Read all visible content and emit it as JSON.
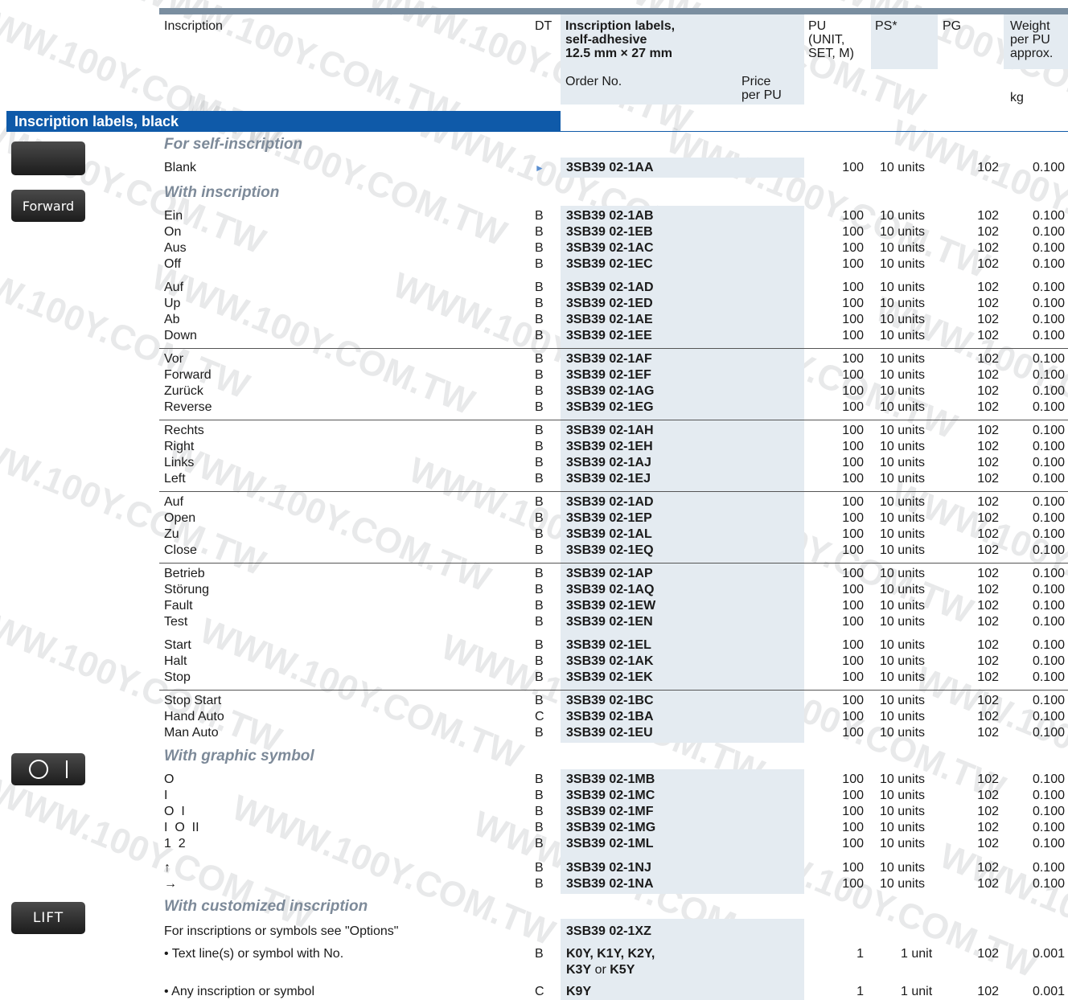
{
  "watermark": "WWW.100Y.COM.TW",
  "header": {
    "inscription": "Inscription",
    "dt": "DT",
    "product_title_l1": "Inscription labels,",
    "product_title_l2": "self-adhesive",
    "product_title_l3": "12.5 mm × 27 mm",
    "order_no": "Order No.",
    "price_l1": "Price",
    "price_l2": "per PU",
    "pu_l1": "PU",
    "pu_l2": "(UNIT,",
    "pu_l3": "SET, M)",
    "ps": "PS*",
    "pg": "PG",
    "weight_l1": "Weight",
    "weight_l2": "per PU",
    "weight_l3": "approx.",
    "kg": "kg"
  },
  "section_title": "Inscription labels, black",
  "subsections": {
    "self": "For self-inscription",
    "inscription": "With inscription",
    "graphic": "With graphic symbol",
    "custom": "With customized inscription"
  },
  "buttons": {
    "forward": "Forward",
    "lift": "LIFT"
  },
  "rows": [
    {
      "insc": "Blank",
      "dt": "►",
      "order": "3SB39 02-1AA",
      "pu": "100",
      "ps": "10 units",
      "pg": "102",
      "wt": "0.100"
    },
    {
      "insc": "Ein",
      "dt": "B",
      "order": "3SB39 02-1AB",
      "pu": "100",
      "ps": "10 units",
      "pg": "102",
      "wt": "0.100"
    },
    {
      "insc": "On",
      "dt": "B",
      "order": "3SB39 02-1EB",
      "pu": "100",
      "ps": "10 units",
      "pg": "102",
      "wt": "0.100"
    },
    {
      "insc": "Aus",
      "dt": "B",
      "order": "3SB39 02-1AC",
      "pu": "100",
      "ps": "10 units",
      "pg": "102",
      "wt": "0.100"
    },
    {
      "insc": "Off",
      "dt": "B",
      "order": "3SB39 02-1EC",
      "pu": "100",
      "ps": "10 units",
      "pg": "102",
      "wt": "0.100"
    },
    {
      "insc": "Auf",
      "dt": "B",
      "order": "3SB39 02-1AD",
      "pu": "100",
      "ps": "10 units",
      "pg": "102",
      "wt": "0.100"
    },
    {
      "insc": "Up",
      "dt": "B",
      "order": "3SB39 02-1ED",
      "pu": "100",
      "ps": "10 units",
      "pg": "102",
      "wt": "0.100"
    },
    {
      "insc": "Ab",
      "dt": "B",
      "order": "3SB39 02-1AE",
      "pu": "100",
      "ps": "10 units",
      "pg": "102",
      "wt": "0.100"
    },
    {
      "insc": "Down",
      "dt": "B",
      "order": "3SB39 02-1EE",
      "pu": "100",
      "ps": "10 units",
      "pg": "102",
      "wt": "0.100"
    },
    {
      "insc": "Vor",
      "dt": "B",
      "order": "3SB39 02-1AF",
      "pu": "100",
      "ps": "10 units",
      "pg": "102",
      "wt": "0.100"
    },
    {
      "insc": "Forward",
      "dt": "B",
      "order": "3SB39 02-1EF",
      "pu": "100",
      "ps": "10 units",
      "pg": "102",
      "wt": "0.100"
    },
    {
      "insc": "Zurück",
      "dt": "B",
      "order": "3SB39 02-1AG",
      "pu": "100",
      "ps": "10 units",
      "pg": "102",
      "wt": "0.100"
    },
    {
      "insc": "Reverse",
      "dt": "B",
      "order": "3SB39 02-1EG",
      "pu": "100",
      "ps": "10 units",
      "pg": "102",
      "wt": "0.100"
    },
    {
      "insc": "Rechts",
      "dt": "B",
      "order": "3SB39 02-1AH",
      "pu": "100",
      "ps": "10 units",
      "pg": "102",
      "wt": "0.100"
    },
    {
      "insc": "Right",
      "dt": "B",
      "order": "3SB39 02-1EH",
      "pu": "100",
      "ps": "10 units",
      "pg": "102",
      "wt": "0.100"
    },
    {
      "insc": "Links",
      "dt": "B",
      "order": "3SB39 02-1AJ",
      "pu": "100",
      "ps": "10 units",
      "pg": "102",
      "wt": "0.100"
    },
    {
      "insc": "Left",
      "dt": "B",
      "order": "3SB39 02-1EJ",
      "pu": "100",
      "ps": "10 units",
      "pg": "102",
      "wt": "0.100"
    },
    {
      "insc": "Auf",
      "dt": "B",
      "order": "3SB39 02-1AD",
      "pu": "100",
      "ps": "10 units",
      "pg": "102",
      "wt": "0.100"
    },
    {
      "insc": "Open",
      "dt": "B",
      "order": "3SB39 02-1EP",
      "pu": "100",
      "ps": "10 units",
      "pg": "102",
      "wt": "0.100"
    },
    {
      "insc": "Zu",
      "dt": "B",
      "order": "3SB39 02-1AL",
      "pu": "100",
      "ps": "10 units",
      "pg": "102",
      "wt": "0.100"
    },
    {
      "insc": "Close",
      "dt": "B",
      "order": "3SB39 02-1EQ",
      "pu": "100",
      "ps": "10 units",
      "pg": "102",
      "wt": "0.100"
    },
    {
      "insc": "Betrieb",
      "dt": "B",
      "order": "3SB39 02-1AP",
      "pu": "100",
      "ps": "10 units",
      "pg": "102",
      "wt": "0.100"
    },
    {
      "insc": "Störung",
      "dt": "B",
      "order": "3SB39 02-1AQ",
      "pu": "100",
      "ps": "10 units",
      "pg": "102",
      "wt": "0.100"
    },
    {
      "insc": "Fault",
      "dt": "B",
      "order": "3SB39 02-1EW",
      "pu": "100",
      "ps": "10 units",
      "pg": "102",
      "wt": "0.100"
    },
    {
      "insc": "Test",
      "dt": "B",
      "order": "3SB39 02-1EN",
      "pu": "100",
      "ps": "10 units",
      "pg": "102",
      "wt": "0.100"
    },
    {
      "insc": "Start",
      "dt": "B",
      "order": "3SB39 02-1EL",
      "pu": "100",
      "ps": "10 units",
      "pg": "102",
      "wt": "0.100"
    },
    {
      "insc": "Halt",
      "dt": "B",
      "order": "3SB39 02-1AK",
      "pu": "100",
      "ps": "10 units",
      "pg": "102",
      "wt": "0.100"
    },
    {
      "insc": "Stop",
      "dt": "B",
      "order": "3SB39 02-1EK",
      "pu": "100",
      "ps": "10 units",
      "pg": "102",
      "wt": "0.100"
    },
    {
      "insc": "Stop Start",
      "dt": "B",
      "order": "3SB39 02-1BC",
      "pu": "100",
      "ps": "10 units",
      "pg": "102",
      "wt": "0.100"
    },
    {
      "insc": "Hand Auto",
      "dt": "C",
      "order": "3SB39 02-1BA",
      "pu": "100",
      "ps": "10 units",
      "pg": "102",
      "wt": "0.100"
    },
    {
      "insc": "Man Auto",
      "dt": "B",
      "order": "3SB39 02-1EU",
      "pu": "100",
      "ps": "10 units",
      "pg": "102",
      "wt": "0.100"
    },
    {
      "insc": "O",
      "dt": "B",
      "order": "3SB39 02-1MB",
      "pu": "100",
      "ps": "10 units",
      "pg": "102",
      "wt": "0.100"
    },
    {
      "insc": "I",
      "dt": "B",
      "order": "3SB39 02-1MC",
      "pu": "100",
      "ps": "10 units",
      "pg": "102",
      "wt": "0.100"
    },
    {
      "insc": "O  I",
      "dt": "B",
      "order": "3SB39 02-1MF",
      "pu": "100",
      "ps": "10 units",
      "pg": "102",
      "wt": "0.100"
    },
    {
      "insc": "I  O  II",
      "dt": "B",
      "order": "3SB39 02-1MG",
      "pu": "100",
      "ps": "10 units",
      "pg": "102",
      "wt": "0.100"
    },
    {
      "insc": "1  2",
      "dt": "B",
      "order": "3SB39 02-1ML",
      "pu": "100",
      "ps": "10 units",
      "pg": "102",
      "wt": "0.100"
    },
    {
      "insc": "↑",
      "dt": "B",
      "order": "3SB39 02-1NJ",
      "pu": "100",
      "ps": "10 units",
      "pg": "102",
      "wt": "0.100"
    },
    {
      "insc": "→",
      "dt": "B",
      "order": "3SB39 02-1NA",
      "pu": "100",
      "ps": "10 units",
      "pg": "102",
      "wt": "0.100"
    }
  ],
  "custom": {
    "note": "For inscriptions or symbols see \"Options\"",
    "note_order": "3SB39 02-1XZ",
    "line1_insc": "• Text line(s) or symbol with No.",
    "line1_dt": "B",
    "line1_order_a": "K0Y, K1Y, K2Y,",
    "line1_order_b1": "K3Y",
    "line1_order_or": " or ",
    "line1_order_b2": "K5Y",
    "line1_pu": "1",
    "line1_ps": "1 unit",
    "line1_pg": "102",
    "line1_wt": "0.001",
    "line2_insc": "• Any inscription or symbol",
    "line2_dt": "C",
    "line2_order": "K9Y",
    "line2_pu": "1",
    "line2_ps": "1 unit",
    "line2_pg": "102",
    "line2_wt": "0.001"
  }
}
